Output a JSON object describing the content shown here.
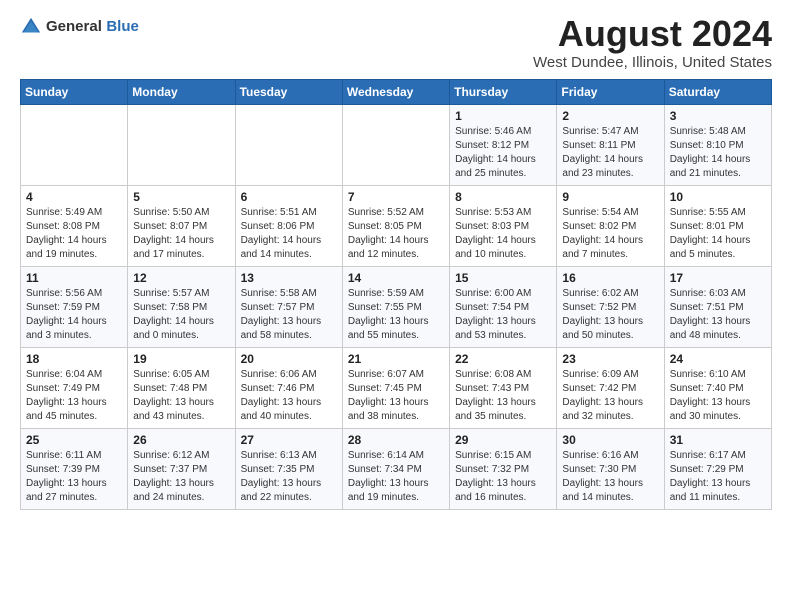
{
  "header": {
    "logo_general": "General",
    "logo_blue": "Blue",
    "month": "August 2024",
    "location": "West Dundee, Illinois, United States"
  },
  "weekdays": [
    "Sunday",
    "Monday",
    "Tuesday",
    "Wednesday",
    "Thursday",
    "Friday",
    "Saturday"
  ],
  "weeks": [
    [
      {
        "day": "",
        "sunrise": "",
        "sunset": "",
        "daylight": ""
      },
      {
        "day": "",
        "sunrise": "",
        "sunset": "",
        "daylight": ""
      },
      {
        "day": "",
        "sunrise": "",
        "sunset": "",
        "daylight": ""
      },
      {
        "day": "",
        "sunrise": "",
        "sunset": "",
        "daylight": ""
      },
      {
        "day": "1",
        "sunrise": "Sunrise: 5:46 AM",
        "sunset": "Sunset: 8:12 PM",
        "daylight": "Daylight: 14 hours and 25 minutes."
      },
      {
        "day": "2",
        "sunrise": "Sunrise: 5:47 AM",
        "sunset": "Sunset: 8:11 PM",
        "daylight": "Daylight: 14 hours and 23 minutes."
      },
      {
        "day": "3",
        "sunrise": "Sunrise: 5:48 AM",
        "sunset": "Sunset: 8:10 PM",
        "daylight": "Daylight: 14 hours and 21 minutes."
      }
    ],
    [
      {
        "day": "4",
        "sunrise": "Sunrise: 5:49 AM",
        "sunset": "Sunset: 8:08 PM",
        "daylight": "Daylight: 14 hours and 19 minutes."
      },
      {
        "day": "5",
        "sunrise": "Sunrise: 5:50 AM",
        "sunset": "Sunset: 8:07 PM",
        "daylight": "Daylight: 14 hours and 17 minutes."
      },
      {
        "day": "6",
        "sunrise": "Sunrise: 5:51 AM",
        "sunset": "Sunset: 8:06 PM",
        "daylight": "Daylight: 14 hours and 14 minutes."
      },
      {
        "day": "7",
        "sunrise": "Sunrise: 5:52 AM",
        "sunset": "Sunset: 8:05 PM",
        "daylight": "Daylight: 14 hours and 12 minutes."
      },
      {
        "day": "8",
        "sunrise": "Sunrise: 5:53 AM",
        "sunset": "Sunset: 8:03 PM",
        "daylight": "Daylight: 14 hours and 10 minutes."
      },
      {
        "day": "9",
        "sunrise": "Sunrise: 5:54 AM",
        "sunset": "Sunset: 8:02 PM",
        "daylight": "Daylight: 14 hours and 7 minutes."
      },
      {
        "day": "10",
        "sunrise": "Sunrise: 5:55 AM",
        "sunset": "Sunset: 8:01 PM",
        "daylight": "Daylight: 14 hours and 5 minutes."
      }
    ],
    [
      {
        "day": "11",
        "sunrise": "Sunrise: 5:56 AM",
        "sunset": "Sunset: 7:59 PM",
        "daylight": "Daylight: 14 hours and 3 minutes."
      },
      {
        "day": "12",
        "sunrise": "Sunrise: 5:57 AM",
        "sunset": "Sunset: 7:58 PM",
        "daylight": "Daylight: 14 hours and 0 minutes."
      },
      {
        "day": "13",
        "sunrise": "Sunrise: 5:58 AM",
        "sunset": "Sunset: 7:57 PM",
        "daylight": "Daylight: 13 hours and 58 minutes."
      },
      {
        "day": "14",
        "sunrise": "Sunrise: 5:59 AM",
        "sunset": "Sunset: 7:55 PM",
        "daylight": "Daylight: 13 hours and 55 minutes."
      },
      {
        "day": "15",
        "sunrise": "Sunrise: 6:00 AM",
        "sunset": "Sunset: 7:54 PM",
        "daylight": "Daylight: 13 hours and 53 minutes."
      },
      {
        "day": "16",
        "sunrise": "Sunrise: 6:02 AM",
        "sunset": "Sunset: 7:52 PM",
        "daylight": "Daylight: 13 hours and 50 minutes."
      },
      {
        "day": "17",
        "sunrise": "Sunrise: 6:03 AM",
        "sunset": "Sunset: 7:51 PM",
        "daylight": "Daylight: 13 hours and 48 minutes."
      }
    ],
    [
      {
        "day": "18",
        "sunrise": "Sunrise: 6:04 AM",
        "sunset": "Sunset: 7:49 PM",
        "daylight": "Daylight: 13 hours and 45 minutes."
      },
      {
        "day": "19",
        "sunrise": "Sunrise: 6:05 AM",
        "sunset": "Sunset: 7:48 PM",
        "daylight": "Daylight: 13 hours and 43 minutes."
      },
      {
        "day": "20",
        "sunrise": "Sunrise: 6:06 AM",
        "sunset": "Sunset: 7:46 PM",
        "daylight": "Daylight: 13 hours and 40 minutes."
      },
      {
        "day": "21",
        "sunrise": "Sunrise: 6:07 AM",
        "sunset": "Sunset: 7:45 PM",
        "daylight": "Daylight: 13 hours and 38 minutes."
      },
      {
        "day": "22",
        "sunrise": "Sunrise: 6:08 AM",
        "sunset": "Sunset: 7:43 PM",
        "daylight": "Daylight: 13 hours and 35 minutes."
      },
      {
        "day": "23",
        "sunrise": "Sunrise: 6:09 AM",
        "sunset": "Sunset: 7:42 PM",
        "daylight": "Daylight: 13 hours and 32 minutes."
      },
      {
        "day": "24",
        "sunrise": "Sunrise: 6:10 AM",
        "sunset": "Sunset: 7:40 PM",
        "daylight": "Daylight: 13 hours and 30 minutes."
      }
    ],
    [
      {
        "day": "25",
        "sunrise": "Sunrise: 6:11 AM",
        "sunset": "Sunset: 7:39 PM",
        "daylight": "Daylight: 13 hours and 27 minutes."
      },
      {
        "day": "26",
        "sunrise": "Sunrise: 6:12 AM",
        "sunset": "Sunset: 7:37 PM",
        "daylight": "Daylight: 13 hours and 24 minutes."
      },
      {
        "day": "27",
        "sunrise": "Sunrise: 6:13 AM",
        "sunset": "Sunset: 7:35 PM",
        "daylight": "Daylight: 13 hours and 22 minutes."
      },
      {
        "day": "28",
        "sunrise": "Sunrise: 6:14 AM",
        "sunset": "Sunset: 7:34 PM",
        "daylight": "Daylight: 13 hours and 19 minutes."
      },
      {
        "day": "29",
        "sunrise": "Sunrise: 6:15 AM",
        "sunset": "Sunset: 7:32 PM",
        "daylight": "Daylight: 13 hours and 16 minutes."
      },
      {
        "day": "30",
        "sunrise": "Sunrise: 6:16 AM",
        "sunset": "Sunset: 7:30 PM",
        "daylight": "Daylight: 13 hours and 14 minutes."
      },
      {
        "day": "31",
        "sunrise": "Sunrise: 6:17 AM",
        "sunset": "Sunset: 7:29 PM",
        "daylight": "Daylight: 13 hours and 11 minutes."
      }
    ]
  ]
}
